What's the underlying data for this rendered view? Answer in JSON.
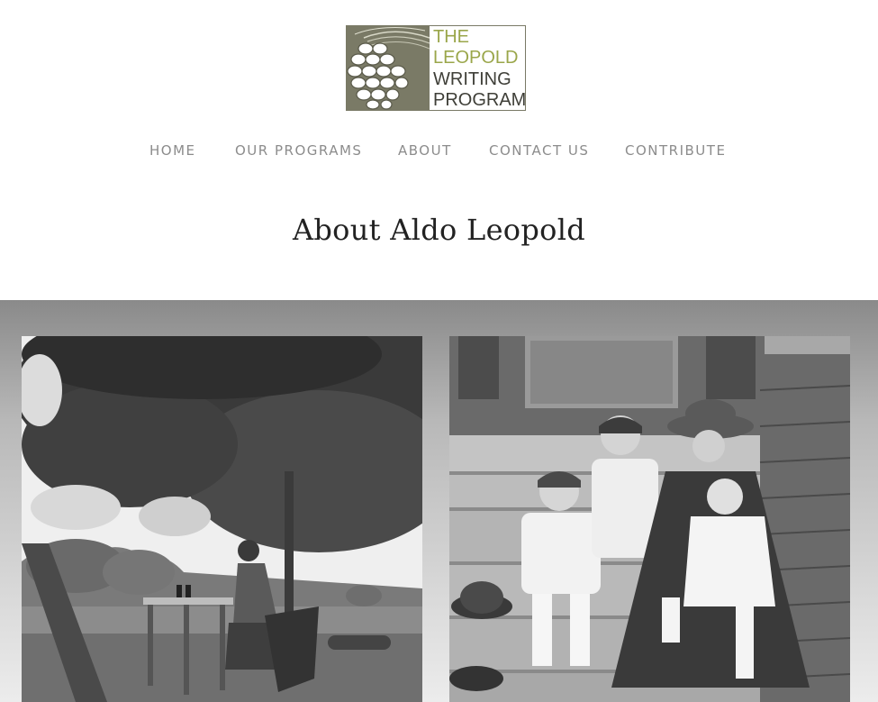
{
  "logo": {
    "lines": [
      "THE",
      "LEOPOLD",
      "WRITING",
      "PROGRAM"
    ],
    "mark_icon": "pinecone-icon",
    "colors": {
      "mark_bg": "#7a7a66",
      "accent": "#9aa64a",
      "dark": "#3f3f38"
    }
  },
  "nav": {
    "items": [
      {
        "label": "HOME"
      },
      {
        "label": "OUR PROGRAMS"
      },
      {
        "label": "ABOUT"
      },
      {
        "label": "CONTACT US"
      },
      {
        "label": "CONTRIBUTE"
      }
    ]
  },
  "page": {
    "title": "About Aldo Leopold"
  },
  "gallery": {
    "photos": [
      {
        "name": "photo-leopold-writing-under-tree"
      },
      {
        "name": "photo-family-on-porch-steps"
      }
    ]
  },
  "colors": {
    "nav_text": "#8c8c8c",
    "title_text": "#222222"
  }
}
